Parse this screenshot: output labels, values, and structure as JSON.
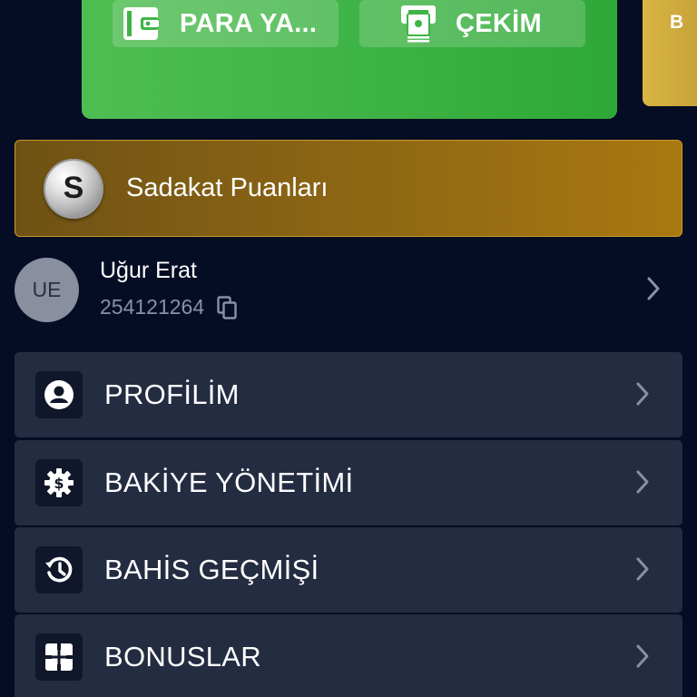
{
  "wallet": {
    "deposit_label": "PARA YA...",
    "withdraw_label": "ÇEKİM",
    "deposit_icon": "wallet-icon",
    "withdraw_icon": "cash-withdraw-icon"
  },
  "side_card": {
    "letter": "B"
  },
  "loyalty": {
    "badge_letter": "S",
    "title": "Sadakat Puanları"
  },
  "user": {
    "initials": "UE",
    "name": "Uğur Erat",
    "id": "254121264"
  },
  "menu": [
    {
      "label": "PROFİLİM",
      "icon": "account-circle-icon"
    },
    {
      "label": "BAKİYE YÖNETİMİ",
      "icon": "balance-settings-icon"
    },
    {
      "label": "BAHİS GEÇMİŞİ",
      "icon": "history-icon"
    },
    {
      "label": "BONUSLAR",
      "icon": "bonus-gift-icon"
    }
  ],
  "colors": {
    "background": "#050d24",
    "wallet_green": "#3fb446",
    "loyalty_gold": "#8a6414",
    "menu_item_bg": "#232c40",
    "muted_text": "#8a90a4"
  }
}
